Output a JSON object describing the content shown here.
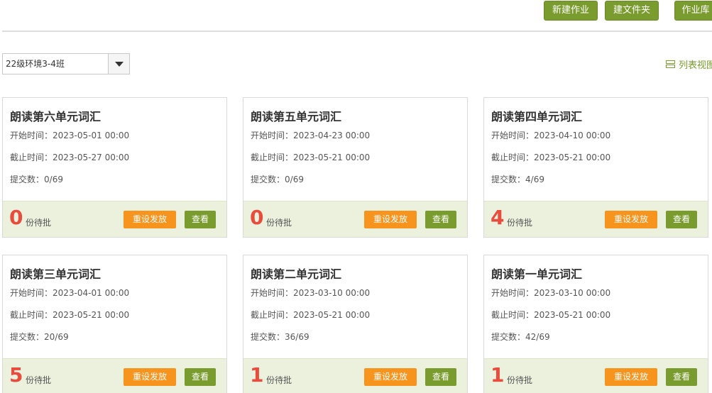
{
  "toolbar": {
    "new_homework": "新建作业",
    "new_folder": "建文件夹",
    "homework_library": "作业库"
  },
  "class_select": {
    "selected": "22级环境3-4班"
  },
  "list_view_label": "列表视图",
  "card_labels": {
    "start_prefix": "开始时间：",
    "deadline_prefix": "截止时间：",
    "submitted_prefix": "提交数：",
    "pending_suffix": "份待批",
    "reset_button": "重设发放",
    "view_button": "查看"
  },
  "cards": [
    {
      "title": "朗读第六单元词汇",
      "start": "2023-05-01 00:00",
      "deadline": "2023-05-27 00:00",
      "submitted": "0/69",
      "pending": "0"
    },
    {
      "title": "朗读第五单元词汇",
      "start": "2023-04-23 00:00",
      "deadline": "2023-05-21 00:00",
      "submitted": "0/69",
      "pending": "0"
    },
    {
      "title": "朗读第四单元词汇",
      "start": "2023-04-10 00:00",
      "deadline": "2023-05-21 00:00",
      "submitted": "4/69",
      "pending": "4"
    },
    {
      "title": "朗读第三单元词汇",
      "start": "2023-04-01 00:00",
      "deadline": "2023-05-21 00:00",
      "submitted": "20/69",
      "pending": "5"
    },
    {
      "title": "朗读第二单元词汇",
      "start": "2023-03-10 00:00",
      "deadline": "2023-05-21 00:00",
      "submitted": "36/69",
      "pending": "1"
    },
    {
      "title": "朗读第一单元词汇",
      "start": "2023-03-10 00:00",
      "deadline": "2023-05-21 00:00",
      "submitted": "42/69",
      "pending": "1"
    }
  ],
  "colors": {
    "accent_green": "#7a9c2e",
    "accent_orange": "#f7941d",
    "pending_red": "#e84c3d",
    "footer_bg": "#ebf1dd"
  }
}
